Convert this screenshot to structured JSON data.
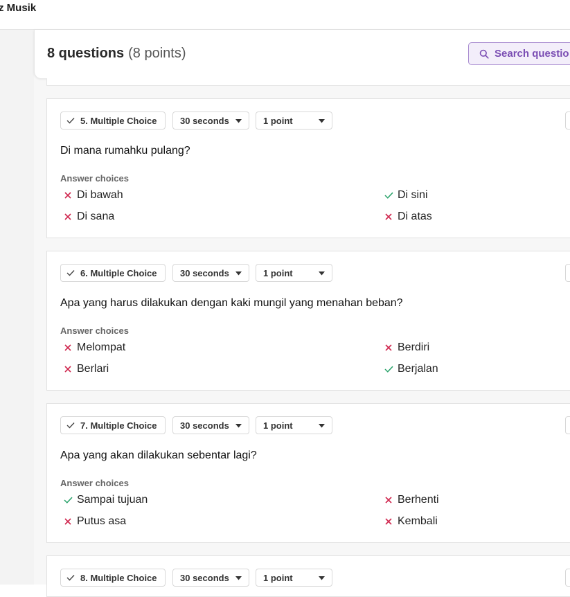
{
  "app": {
    "title": "z Musik"
  },
  "summary": {
    "count_label": "8 questions",
    "points_label": "(8 points)"
  },
  "search": {
    "label": "Search questio"
  },
  "answer_choices_label": "Answer choices",
  "colors": {
    "correct": "#2aa36b",
    "incorrect": "#d0284f",
    "accent": "#7a4db3"
  },
  "questions": [
    {
      "type_label": "5. Multiple Choice",
      "time_label": "30 seconds",
      "points_label": "1 point",
      "text": "Di mana rumahku pulang?",
      "choices": [
        {
          "text": "Di bawah",
          "correct": false
        },
        {
          "text": "Di sini",
          "correct": true
        },
        {
          "text": "Di sana",
          "correct": false
        },
        {
          "text": "Di atas",
          "correct": false
        }
      ]
    },
    {
      "type_label": "6. Multiple Choice",
      "time_label": "30 seconds",
      "points_label": "1 point",
      "text": "Apa yang harus dilakukan dengan kaki mungil yang menahan beban?",
      "choices": [
        {
          "text": "Melompat",
          "correct": false
        },
        {
          "text": "Berdiri",
          "correct": false
        },
        {
          "text": "Berlari",
          "correct": false
        },
        {
          "text": "Berjalan",
          "correct": true
        }
      ]
    },
    {
      "type_label": "7. Multiple Choice",
      "time_label": "30 seconds",
      "points_label": "1 point",
      "text": "Apa yang akan dilakukan sebentar lagi?",
      "choices": [
        {
          "text": "Sampai tujuan",
          "correct": true
        },
        {
          "text": "Berhenti",
          "correct": false
        },
        {
          "text": "Putus asa",
          "correct": false
        },
        {
          "text": "Kembali",
          "correct": false
        }
      ]
    },
    {
      "type_label": "8. Multiple Choice",
      "time_label": "30 seconds",
      "points_label": "1 point"
    }
  ]
}
